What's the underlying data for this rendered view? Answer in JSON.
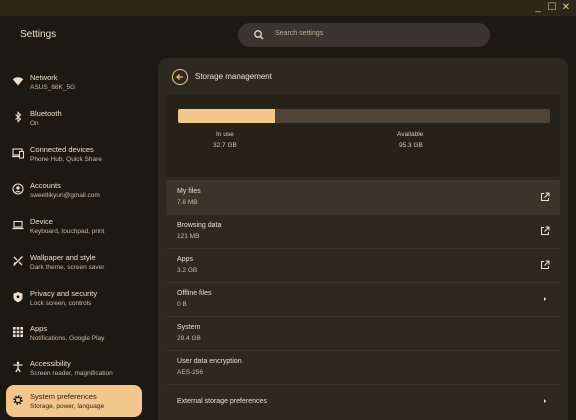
{
  "window": {
    "app_title": "Settings",
    "controls": {
      "minimize": "_",
      "maximize": "☐",
      "close": "✕"
    }
  },
  "search": {
    "placeholder": "Search settings"
  },
  "sidebar": {
    "items": [
      {
        "title": "Network",
        "subtitle": "ASUS_68K_5G",
        "icon": "wifi-icon"
      },
      {
        "title": "Bluetooth",
        "subtitle": "On",
        "icon": "bluetooth-icon"
      },
      {
        "title": "Connected devices",
        "subtitle": "Phone Hub, Quick Share",
        "icon": "phone-laptop-icon"
      },
      {
        "title": "Accounts",
        "subtitle": "sweetlikyuri@gmail.com",
        "icon": "account-icon"
      },
      {
        "title": "Device",
        "subtitle": "Keyboard, touchpad, print",
        "icon": "laptop-icon"
      },
      {
        "title": "Wallpaper and style",
        "subtitle": "Dark theme, screen saver",
        "icon": "palette-icon"
      },
      {
        "title": "Privacy and security",
        "subtitle": "Lock screen, controls",
        "icon": "shield-icon"
      },
      {
        "title": "Apps",
        "subtitle": "Notifications, Google Play",
        "icon": "apps-grid-icon"
      },
      {
        "title": "Accessibility",
        "subtitle": "Screen reader, magnification",
        "icon": "accessibility-icon"
      },
      {
        "title": "System preferences",
        "subtitle": "Storage, power, language",
        "icon": "gear-icon",
        "active": true
      }
    ]
  },
  "page": {
    "title": "Storage management",
    "storage": {
      "in_use_label": "In use",
      "in_use_value": "32.7 GB",
      "available_label": "Available",
      "available_value": "95.3 GB",
      "used_fraction": 0.26
    },
    "rows": [
      {
        "title": "My files",
        "value": "7.6 MB",
        "icon": "open-external-icon"
      },
      {
        "title": "Browsing data",
        "value": "121 MB",
        "icon": "open-external-icon"
      },
      {
        "title": "Apps",
        "value": "3.2 GB",
        "icon": "open-external-icon"
      },
      {
        "title": "Offline files",
        "value": "0 B",
        "icon": "chevron-right-icon"
      },
      {
        "title": "System",
        "value": "29.4 GB"
      },
      {
        "title": "User data encryption",
        "value": "AES-256"
      }
    ],
    "external": {
      "title": "External storage preferences",
      "icon": "chevron-right-icon"
    }
  },
  "colors": {
    "accent": "#f3c68d",
    "background": "#1c1812",
    "panel": "#2d2820",
    "text": "#ece1cf"
  }
}
